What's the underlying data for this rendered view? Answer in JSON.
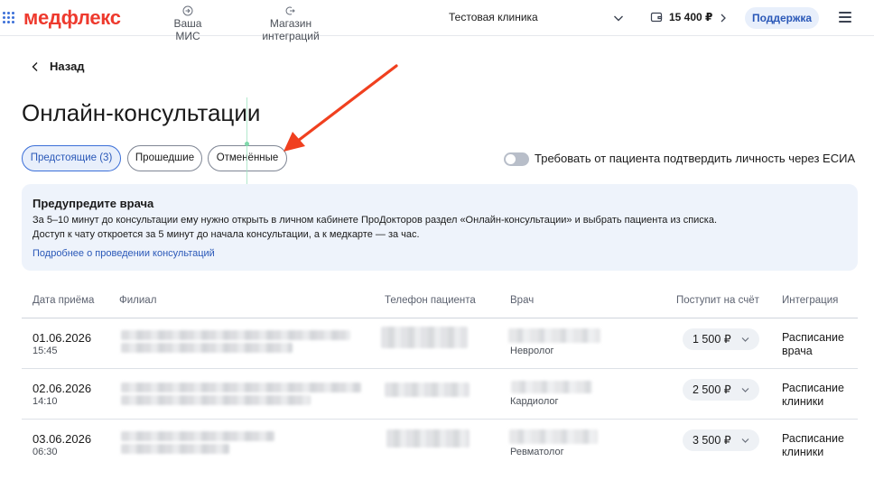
{
  "header": {
    "logo": "медфлекс",
    "nav": [
      {
        "label": "Ваша МИС",
        "icon": "login-icon"
      },
      {
        "label": "Магазин интеграций",
        "icon": "logout-icon"
      }
    ],
    "clinic": "Тестовая клиника",
    "balance": "15 400 ₽",
    "support_label": "Поддержка"
  },
  "back_label": "Назад",
  "page_title": "Онлайн-консультации",
  "tabs": [
    {
      "label": "Предстоящие (3)",
      "active": true
    },
    {
      "label": "Прошедшие",
      "active": false
    },
    {
      "label": "Отменённые",
      "active": false
    }
  ],
  "esia_toggle": {
    "label": "Требовать от пациента подтвердить личность через ЕСИА",
    "enabled": false
  },
  "notice": {
    "title": "Предупредите врача",
    "line1": "За 5–10 минут до консультации ему нужно открыть в личном кабинете ПроДокторов раздел «Онлайн-консультации» и выбрать пациента из списка.",
    "line2": "Доступ к чату откроется за 5 минут до начала консультации, а к медкарте — за час.",
    "link": "Подробнее о проведении консультаций"
  },
  "table": {
    "columns": [
      "Дата приёма",
      "Филиал",
      "Телефон пациента",
      "Врач",
      "Поступит на счёт",
      "Интеграция"
    ],
    "rows": [
      {
        "date": "01.06.2026",
        "time": "15:45",
        "specialty": "Невролог",
        "amount": "1 500 ₽",
        "integration": "Расписание врача"
      },
      {
        "date": "02.06.2026",
        "time": "14:10",
        "specialty": "Кардиолог",
        "amount": "2 500 ₽",
        "integration": "Расписание клиники"
      },
      {
        "date": "03.06.2026",
        "time": "06:30",
        "specialty": "Ревматолог",
        "amount": "3 500 ₽",
        "integration": "Расписание клиники"
      }
    ]
  },
  "colors": {
    "brand": "#ee3a2e",
    "accent": "#2a58b8",
    "annotation_arrow": "#f0401f"
  }
}
